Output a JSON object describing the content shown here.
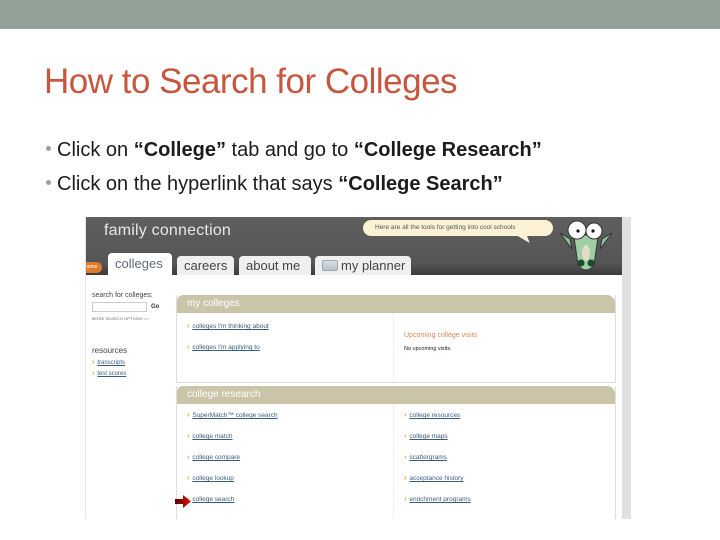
{
  "slide": {
    "title": "How to Search for Colleges",
    "bullets": [
      {
        "parts": [
          {
            "text": "Click on ",
            "bold": false
          },
          {
            "text": "“College”",
            "bold": true
          },
          {
            "text": " tab and  go to ",
            "bold": false
          },
          {
            "text": "“College Research”",
            "bold": true
          }
        ]
      },
      {
        "parts": [
          {
            "text": "Click on the hyperlink that says ",
            "bold": false
          },
          {
            "text": "“College Search”",
            "bold": true
          }
        ]
      }
    ],
    "colors": {
      "title": "#c8553d",
      "top_band": "#92a097"
    }
  },
  "screenshot": {
    "app_name": "family connection",
    "speech_bubble": "Here are all the tools for getting into cool schools",
    "home_button": "home",
    "tabs": [
      {
        "label": "colleges",
        "active": true
      },
      {
        "label": "careers",
        "active": false
      },
      {
        "label": "about me",
        "active": false
      },
      {
        "label": "my planner",
        "active": false,
        "icon": "planner-icon"
      }
    ],
    "sidebar": {
      "search_label": "search for colleges:",
      "search_value": "",
      "go_label": "Go",
      "more_options": "MORE SEARCH OPTIONS >>",
      "resources_title": "resources",
      "resources": [
        "transcripts",
        "test scores"
      ]
    },
    "my_colleges": {
      "title": "my colleges",
      "links": [
        "colleges I'm thinking about",
        "colleges I'm applying to"
      ],
      "visits_title": "Upcoming college visits",
      "visits_text": "No upcoming visits."
    },
    "college_research": {
      "title": "college research",
      "left_links": [
        "SuperMatch™ college search",
        "college match",
        "college compare",
        "college lookup",
        "college search"
      ],
      "right_links": [
        "college resources",
        "college maps",
        "scattergrams",
        "acceptance history",
        "enrichment programs"
      ],
      "highlighted": "college search"
    }
  }
}
